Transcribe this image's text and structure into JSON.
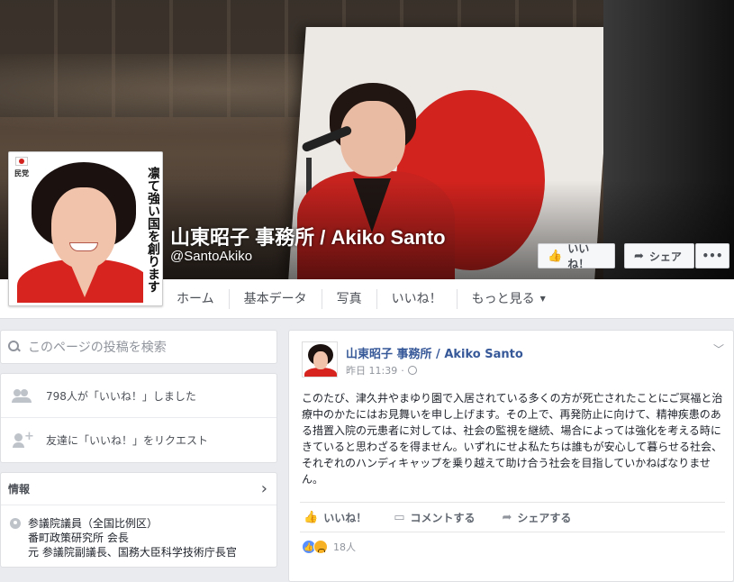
{
  "page": {
    "name": "山東昭子 事務所 / Akiko Santo",
    "handle": "@SantoAkiko"
  },
  "cover_buttons": {
    "like": "いいね！",
    "share": "シェア",
    "more": "•••"
  },
  "profile_pic": {
    "party": "民党",
    "slogan": "凛て強い国を創ります"
  },
  "nav": {
    "items": [
      "ホーム",
      "基本データ",
      "写真",
      "いいね！",
      "もっと見る"
    ]
  },
  "sidebar": {
    "search_placeholder": "このページの投稿を検索",
    "likes": "798人が「いいね！」しました",
    "invite": "友達に「いいね！」をリクエスト",
    "info_title": "情報",
    "info_lines": [
      "参議院議員（全国比例区）",
      "番町政策研究所 会長",
      "元 参議院副議長、国務大臣科学技術庁長官"
    ]
  },
  "post": {
    "author": "山東昭子 事務所 / Akiko Santo",
    "time": "昨日 11:39",
    "text": "このたび、津久井やまゆり園で入居されている多くの方が死亡されたことにご冥福と治療中のかたにはお見舞いを申し上げます。その上で、再発防止に向けて、精神疾患のある措置入院の元患者に対しては、社会の監視を継続、場合によっては強化を考える時にきていると思わざるを得ません。いずれにせよ私たちは誰もが安心して暮らせる社会、それぞれのハンディキャップを乗り越えて助け合う社会を目指していかねばなりません。",
    "actions": {
      "like": "いいね！",
      "comment": "コメントする",
      "share": "シェアする"
    },
    "reaction_count": "18人"
  },
  "colors": {
    "link_blue": "#365899",
    "background": "#e9ebee",
    "flag_red": "#d3231e"
  }
}
